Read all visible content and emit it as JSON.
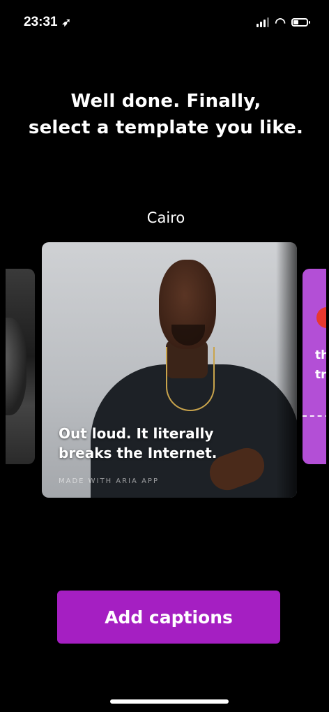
{
  "status_bar": {
    "time": "23:31",
    "location_glyph": "➶",
    "wifi_glyph": "◠"
  },
  "headline": {
    "line1": "Well done. Finally,",
    "line2": "select a template you like."
  },
  "carousel": {
    "selected_template": "Cairo",
    "main_card": {
      "caption_line1": "Out loud. It literally",
      "caption_line2": "breaks the Internet.",
      "watermark": "MADE WITH ARIA APP"
    },
    "right_card": {
      "text_line1": "th",
      "text_line2": "tr"
    }
  },
  "actions": {
    "add_captions_label": "Add captions"
  },
  "colors": {
    "background": "#000000",
    "button": "#a51fc2",
    "right_card": "#b34fd6"
  }
}
